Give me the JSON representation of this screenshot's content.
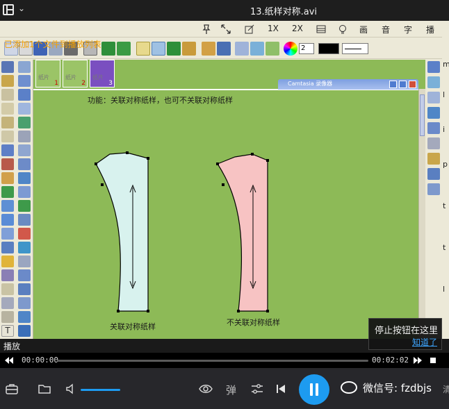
{
  "player": {
    "title": "13.纸样对称.avi",
    "status_label": "播放",
    "time_current": "00:00:00",
    "time_total": "00:02:02",
    "progress": 0.0,
    "volume": 1.0,
    "tooltip_text": "停止按钮在这里",
    "tooltip_ok": "知道了",
    "watermark": "微信号: fzdbjs",
    "danmaku_label": "弹",
    "corner_text": "清",
    "tools": [
      "1X",
      "2X",
      "画",
      "音",
      "字",
      "播"
    ],
    "accent_color": "#1d9bf0"
  },
  "app": {
    "notice": "已添加1个文件到播放列表",
    "color_value": "2",
    "camtasia_title": "Camtasia 录像器",
    "thumbs": [
      {
        "label": "纸片",
        "num": "1"
      },
      {
        "label": "纸片",
        "num": "2"
      },
      {
        "label": "纸片",
        "num": "3"
      }
    ],
    "function_text": "功能：关联对称纸样，也可不关联对称纸样",
    "caption_left": "关联对称纸样",
    "caption_right": "不关联对称纸样",
    "right_strip": [
      "m",
      "l",
      "i",
      "p",
      "t",
      "t",
      "l"
    ]
  }
}
